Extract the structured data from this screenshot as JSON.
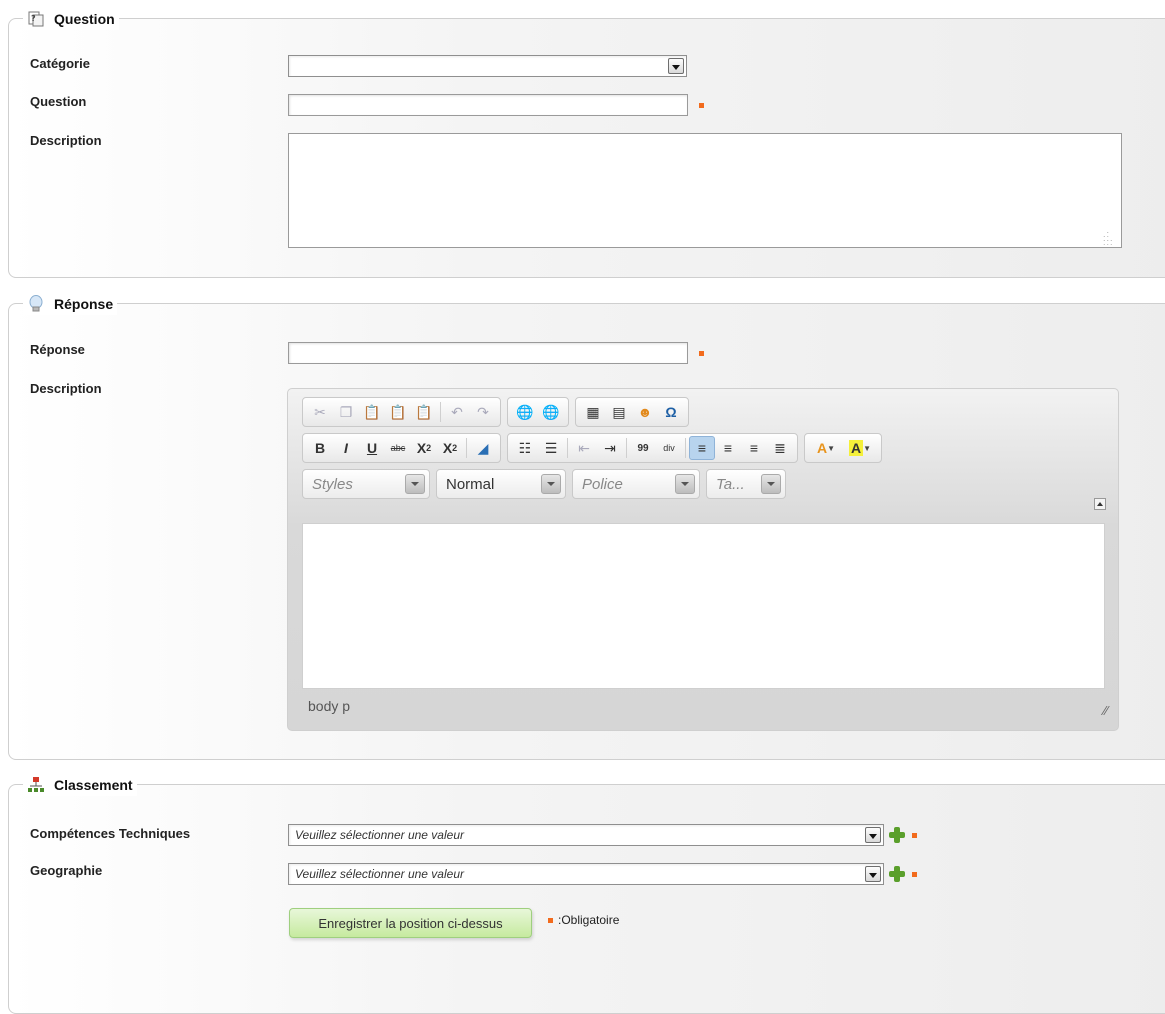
{
  "question": {
    "legend": "Question",
    "icon": "question-page-icon",
    "categorie_label": "Catégorie",
    "categorie_value": "",
    "question_label": "Question",
    "question_value": "",
    "description_label": "Description",
    "description_value": ""
  },
  "reponse": {
    "legend": "Réponse",
    "icon": "lightbulb-icon",
    "reponse_label": "Réponse",
    "reponse_value": "",
    "description_label": "Description",
    "editor": {
      "row1": [
        "cut-icon",
        "copy-icon",
        "paste-icon",
        "paste-text-icon",
        "paste-word-icon",
        "undo-icon",
        "redo-icon",
        "link-icon",
        "unlink-icon",
        "table-icon",
        "horizontal-rule-icon",
        "smiley-icon",
        "special-char-icon"
      ],
      "special_char": "Ω",
      "bold": "B",
      "italic": "I",
      "underline": "U",
      "strike": "abc",
      "subscript_base": "X",
      "subscript_idx": "2",
      "superscript_base": "X",
      "superscript_idx": "2",
      "quote": "99",
      "div": "div",
      "text_color_letter": "A",
      "bg_color_letter": "A",
      "combo_styles": "Styles",
      "combo_format": "Normal",
      "combo_font": "Police",
      "combo_size": "Ta...",
      "status_path": "body  p",
      "active_button": "align-left"
    }
  },
  "classement": {
    "legend": "Classement",
    "icon": "sitemap-icon",
    "competences_label": "Compétences Techniques",
    "competences_value": "Veuillez sélectionner une valeur",
    "geographie_label": "Geographie",
    "geographie_value": "Veuillez sélectionner une valeur",
    "save_label": "Enregistrer la position ci-dessus",
    "required_note": ":Obligatoire"
  },
  "colors": {
    "required": "#f26b1d",
    "save_button": "#c6ea9f",
    "add_icon": "#5a9f2b"
  }
}
